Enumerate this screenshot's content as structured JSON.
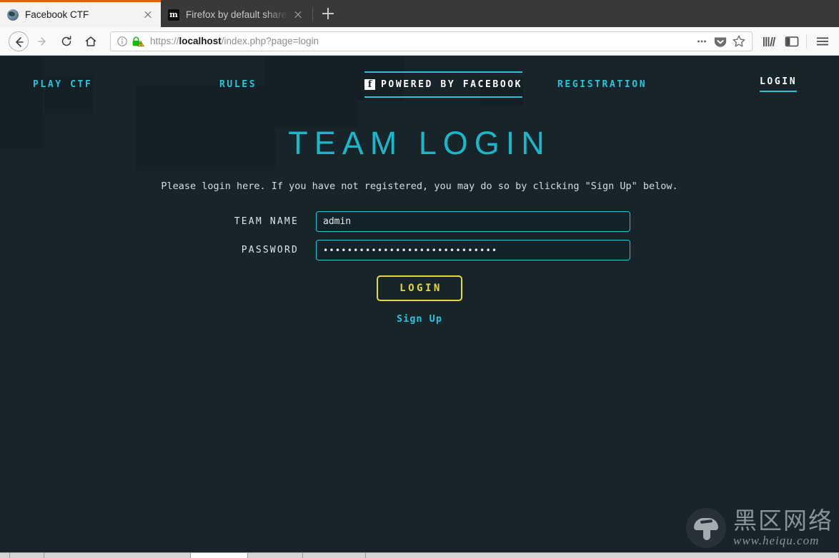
{
  "browser": {
    "tabs": [
      {
        "title": "Facebook CTF",
        "favicon": "globe-icon",
        "active": true
      },
      {
        "title": "Firefox by default shares",
        "favicon": "medium-m-icon",
        "active": false
      }
    ],
    "newtab_label": "+",
    "toolbar": {
      "back_icon": "back-arrow-icon",
      "forward_icon": "forward-arrow-icon",
      "reload_icon": "reload-icon",
      "home_icon": "home-icon",
      "identity_icon": "info-circle-icon",
      "lock_icon": "lock-warning-icon",
      "url_scheme": "https://",
      "url_host": "localhost",
      "url_path": "/index.php?page=login",
      "url_full": "https://localhost/index.php?page=login",
      "page_actions_icon": "ellipsis-icon",
      "pocket_icon": "pocket-icon",
      "bookmark_icon": "star-icon",
      "library_icon": "library-icon",
      "sidebar_icon": "sidebar-icon",
      "menu_icon": "hamburger-menu-icon"
    }
  },
  "site": {
    "nav": [
      {
        "label": "PLAY CTF",
        "state": "link"
      },
      {
        "label": "RULES",
        "state": "link"
      },
      {
        "label": "POWERED BY FACEBOOK",
        "state": "branded",
        "icon": "facebook-icon"
      },
      {
        "label": "REGISTRATION",
        "state": "link"
      },
      {
        "label": "LOGIN",
        "state": "active"
      }
    ],
    "heading": "TEAM LOGIN",
    "description": "Please login here. If you have not registered, you may do so by clicking \"Sign Up\" below.",
    "form": {
      "team_name_label": "TEAM NAME",
      "team_name_value": "admin",
      "team_name_placeholder": "",
      "password_label": "PASSWORD",
      "password_value": "•••••••••••••••••••••••••••••",
      "password_placeholder": "",
      "submit_label": "LOGIN",
      "signup_label": "Sign Up"
    },
    "colors": {
      "background": "#17242a",
      "accent_cyan": "#2cc2d8",
      "title_cyan": "#1fb5c9",
      "button_yellow": "#e6d93c",
      "text_light": "#d6dde0"
    }
  },
  "watermark": {
    "chinese": "黑区网络",
    "url": "www.heiqu.com",
    "logo": "mushroom-icon"
  }
}
